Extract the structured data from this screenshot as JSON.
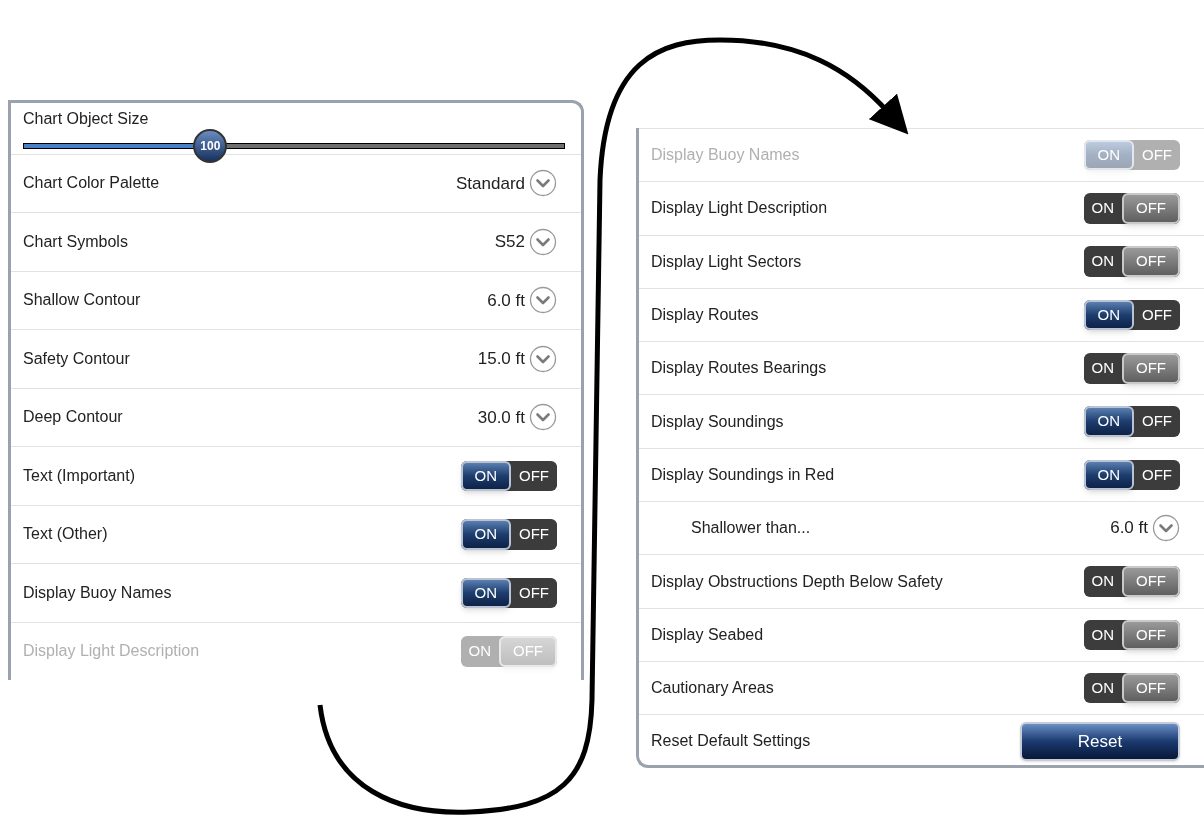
{
  "left_panel": {
    "slider": {
      "label": "Chart Object Size",
      "value": "100",
      "level": 0.345
    },
    "rows": [
      {
        "kind": "select",
        "label": "Chart Color Palette",
        "value": "Standard"
      },
      {
        "kind": "select",
        "label": "Chart Symbols",
        "value": "S52"
      },
      {
        "kind": "select",
        "label": "Shallow Contour",
        "value": "6.0 ft"
      },
      {
        "kind": "select",
        "label": "Safety Contour",
        "value": "15.0 ft"
      },
      {
        "kind": "select",
        "label": "Deep Contour",
        "value": "30.0 ft"
      },
      {
        "kind": "toggle",
        "label": "Text (Important)",
        "on": true,
        "faded": false,
        "on_label": "ON",
        "off_label": "OFF"
      },
      {
        "kind": "toggle",
        "label": "Text (Other)",
        "on": true,
        "faded": false,
        "on_label": "ON",
        "off_label": "OFF"
      },
      {
        "kind": "toggle",
        "label": "Display Buoy Names",
        "on": true,
        "faded": false,
        "on_label": "ON",
        "off_label": "OFF"
      },
      {
        "kind": "toggle",
        "label": "Display Light Description",
        "on": false,
        "faded": true,
        "on_label": "ON",
        "off_label": "OFF"
      }
    ]
  },
  "right_panel": {
    "rows": [
      {
        "kind": "toggle",
        "label": "Display Buoy Names",
        "on": true,
        "faded": true,
        "on_label": "ON",
        "off_label": "OFF"
      },
      {
        "kind": "toggle",
        "label": "Display Light Description",
        "on": false,
        "faded": false,
        "on_label": "ON",
        "off_label": "OFF"
      },
      {
        "kind": "toggle",
        "label": "Display Light Sectors",
        "on": false,
        "faded": false,
        "on_label": "ON",
        "off_label": "OFF"
      },
      {
        "kind": "toggle",
        "label": "Display Routes",
        "on": true,
        "faded": false,
        "on_label": "ON",
        "off_label": "OFF"
      },
      {
        "kind": "toggle",
        "label": "Display Routes Bearings",
        "on": false,
        "faded": false,
        "on_label": "ON",
        "off_label": "OFF"
      },
      {
        "kind": "toggle",
        "label": "Display Soundings",
        "on": true,
        "faded": false,
        "on_label": "ON",
        "off_label": "OFF"
      },
      {
        "kind": "toggle",
        "label": "Display Soundings in Red",
        "on": true,
        "faded": false,
        "on_label": "ON",
        "off_label": "OFF",
        "children": [
          {
            "kind": "select",
            "label": "Shallower than...",
            "value": "6.0 ft"
          }
        ]
      },
      {
        "kind": "toggle",
        "label": "Display Obstructions Depth Below Safety",
        "on": false,
        "faded": false,
        "on_label": "ON",
        "off_label": "OFF"
      },
      {
        "kind": "toggle",
        "label": "Display Seabed",
        "on": false,
        "faded": false,
        "on_label": "ON",
        "off_label": "OFF"
      },
      {
        "kind": "toggle",
        "label": "Cautionary Areas",
        "on": false,
        "faded": false,
        "on_label": "ON",
        "off_label": "OFF"
      },
      {
        "kind": "button",
        "label": "Reset Default Settings",
        "button": "Reset"
      }
    ]
  }
}
